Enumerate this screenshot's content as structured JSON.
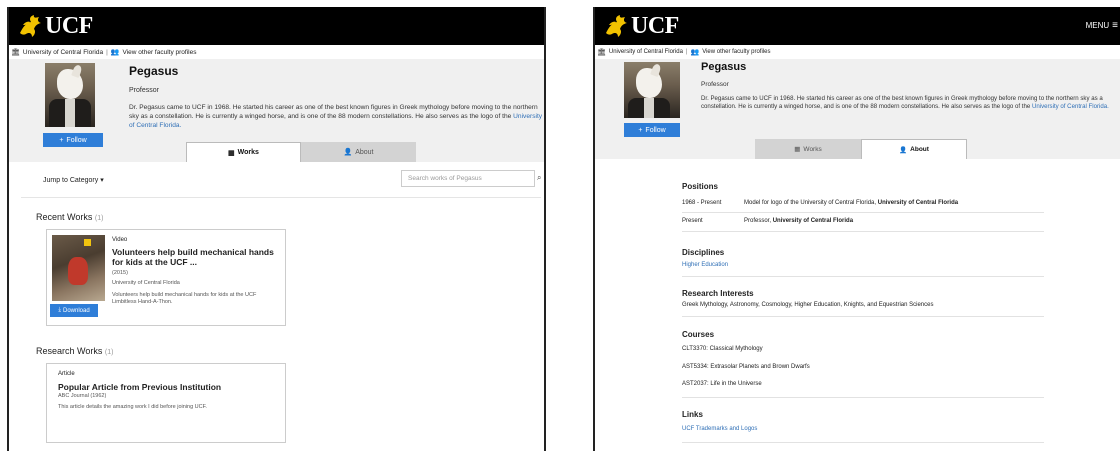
{
  "brand": {
    "logo_text": "UCF",
    "logo_color": "#f2c200"
  },
  "breadcrumb": {
    "university": "University of Central Florida",
    "faculty_profiles": "View other faculty profiles"
  },
  "menu": {
    "label": "MENU"
  },
  "profile": {
    "name": "Pegasus",
    "title": "Professor",
    "bio_text": "Dr. Pegasus came to UCF in 1968.  He started his career as one of the best known figures in Greek mythology before moving to the northern sky as a constellation.  He is currently a winged horse, and is one of the 88 modern constellations.  He also serves as the logo of the",
    "bio_link": "University of Central Florida.",
    "follow_label": "Follow"
  },
  "tabs": {
    "works": "Works",
    "about": "About"
  },
  "works_view": {
    "jump_label": "Jump to Category",
    "search_placeholder": "Search works of Pegasus",
    "recent": {
      "heading": "Recent Works",
      "count": "(1)"
    },
    "recent_item": {
      "type": "Video",
      "title": "Volunteers help build mechanical hands for kids at the UCF ...",
      "year": "(2015)",
      "source": "University of Central Florida",
      "description": "Volunteers help build mechanical hands for kids at the UCF Limbitless Hand-A-Thon.",
      "download_label": "Download"
    },
    "research": {
      "heading": "Research Works",
      "count": "(1)"
    },
    "research_item": {
      "type": "Article",
      "title": "Popular Article from Previous Institution",
      "journal": "ABC Journal (1962)",
      "description": "This article details the amazing work I did before joining UCF."
    }
  },
  "about_view": {
    "positions": {
      "heading": "Positions",
      "rows": [
        {
          "period": "1968 - Present",
          "role": "Model for logo of the University of Central Florida,",
          "org": "University of Central Florida"
        },
        {
          "period": "Present",
          "role": "Professor,",
          "org": "University of Central Florida"
        }
      ]
    },
    "disciplines": {
      "heading": "Disciplines",
      "items": [
        "Higher Education"
      ]
    },
    "research_interests": {
      "heading": "Research Interests",
      "text": "Greek Mythology, Astronomy, Cosmology, Higher Education, Knights, and Equestrian Sciences"
    },
    "courses": {
      "heading": "Courses",
      "items": [
        "CLT3370: Classical Mythology",
        "AST5334: Extrasolar Planets and Brown Dwarfs",
        "AST2037: Life in the Universe"
      ]
    },
    "links": {
      "heading": "Links",
      "items": [
        "UCF Trademarks and Logos"
      ]
    }
  },
  "colors": {
    "accent": "#2f7ed8",
    "link": "#2f6fb6",
    "topbar": "#000000",
    "profile_bg": "#f0f0f0"
  }
}
